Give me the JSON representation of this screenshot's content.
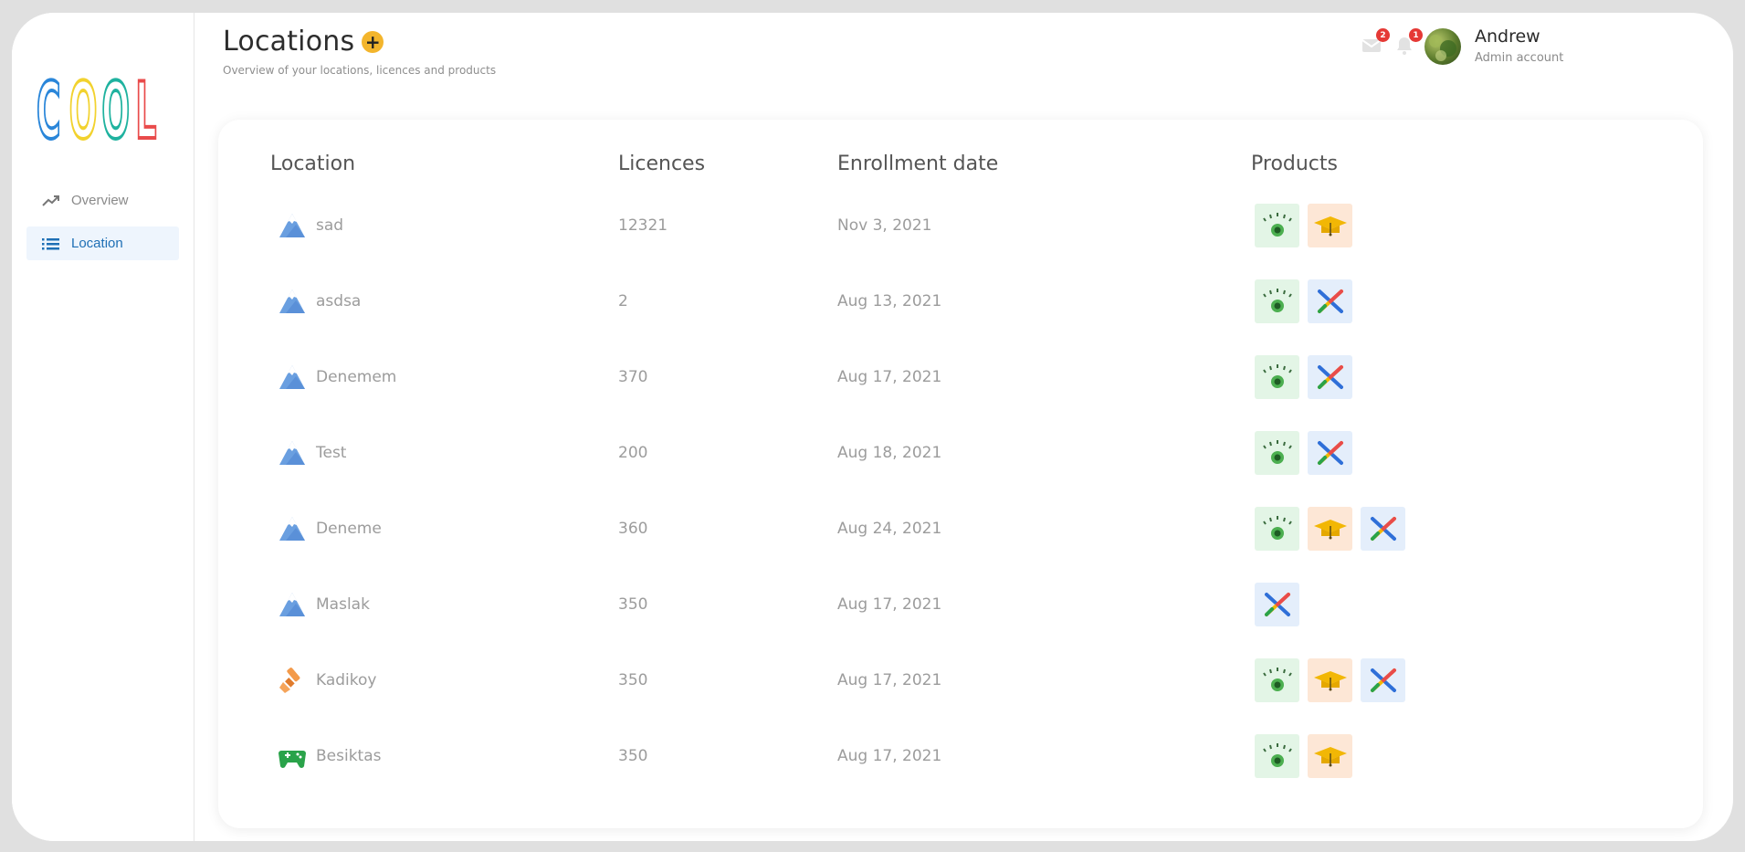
{
  "brand": {
    "logo_text": "COOL",
    "logo_colors": [
      "#2a86d9",
      "#f2d22e",
      "#1fb29f",
      "#e94b4b"
    ]
  },
  "sidebar": {
    "items": [
      {
        "label": "Overview",
        "icon": "trending-up-icon",
        "active": false
      },
      {
        "label": "Location",
        "icon": "list-icon",
        "active": true
      }
    ]
  },
  "header": {
    "title": "Locations",
    "add_label": "+",
    "subtitle": "Overview of your locations, licences and products"
  },
  "notifications": {
    "mail_count": "2",
    "bell_count": "1"
  },
  "user": {
    "name": "Andrew",
    "role": "Admin account"
  },
  "table": {
    "columns": [
      "Location",
      "Licences",
      "Enrollment date",
      "Products"
    ],
    "rows": [
      {
        "location": "sad",
        "icon": "mountain-icon",
        "licences": "12321",
        "date": "Nov 3, 2021",
        "products": [
          "eye",
          "grad"
        ]
      },
      {
        "location": "asdsa",
        "icon": "mountain-icon",
        "licences": "2",
        "date": "Aug 13, 2021",
        "products": [
          "eye",
          "pin"
        ]
      },
      {
        "location": "Denemem",
        "icon": "mountain-icon",
        "licences": "370",
        "date": "Aug 17, 2021",
        "products": [
          "eye",
          "pin"
        ]
      },
      {
        "location": "Test",
        "icon": "mountain-icon",
        "licences": "200",
        "date": "Aug 18, 2021",
        "products": [
          "eye",
          "pin"
        ]
      },
      {
        "location": "Deneme",
        "icon": "mountain-icon",
        "licences": "360",
        "date": "Aug 24, 2021",
        "products": [
          "eye",
          "grad",
          "pin"
        ]
      },
      {
        "location": "Maslak",
        "icon": "mountain-icon",
        "licences": "350",
        "date": "Aug 17, 2021",
        "products": [
          "pin"
        ]
      },
      {
        "location": "Kadikoy",
        "icon": "paintbrush-icon",
        "licences": "350",
        "date": "Aug 17, 2021",
        "products": [
          "eye",
          "grad",
          "pin"
        ]
      },
      {
        "location": "Besiktas",
        "icon": "gamepad-icon",
        "licences": "350",
        "date": "Aug 17, 2021",
        "products": [
          "eye",
          "grad"
        ]
      }
    ]
  },
  "colors": {
    "accent": "#1e6fb5",
    "add_button": "#f3b52c",
    "badge": "#e53935"
  }
}
